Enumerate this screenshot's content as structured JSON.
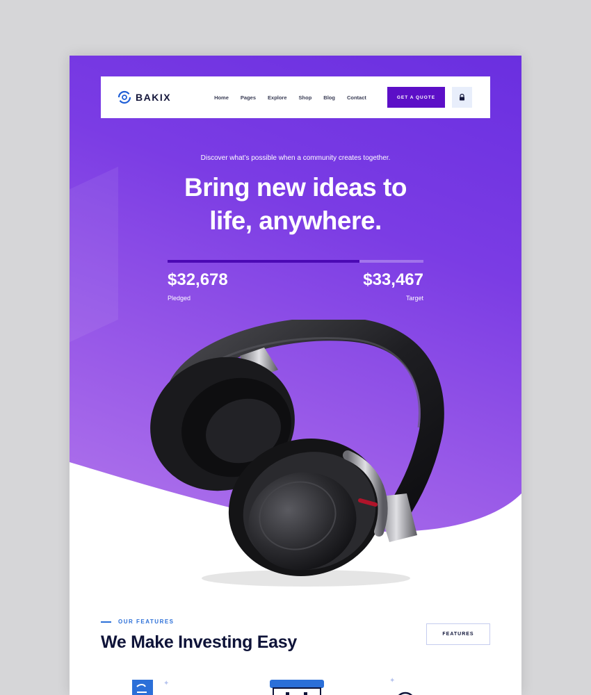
{
  "brand": {
    "name": "BAKIX"
  },
  "nav": {
    "items": [
      "Home",
      "Pages",
      "Explore",
      "Shop",
      "Blog",
      "Contact"
    ],
    "cta_label": "GET A QUOTE",
    "lock_icon": "lock-icon"
  },
  "hero": {
    "tagline": "Discover what’s possible when a community creates together.",
    "title_line1": "Bring new ideas to",
    "title_line2": "life, anywhere.",
    "pledged_amount": "$32,678",
    "pledged_label": "Pledged",
    "target_amount": "$33,467",
    "target_label": "Target",
    "progress_fraction": 0.75,
    "image": "headphones"
  },
  "features": {
    "eyebrow": "OUR FEATURES",
    "title": "We Make Investing Easy",
    "button_label": "FEATURES",
    "icons": [
      "document-icon",
      "monitor-icon",
      "chart-icon"
    ]
  },
  "colors": {
    "hero_top": "#6a2fe0",
    "hero_bottom": "#b277ec",
    "accent": "#5c0fc7",
    "progress_fill": "#4b09b4",
    "heading": "#0e1338",
    "link_blue": "#2b6fd8"
  }
}
